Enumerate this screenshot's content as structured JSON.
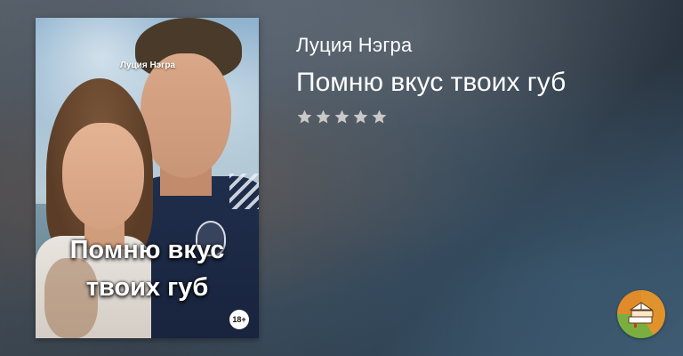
{
  "book": {
    "author": "Луция Нэгра",
    "title": "Помню вкус твоих губ",
    "rating_stars_filled": 0,
    "rating_stars_total": 5,
    "star_color": "#c9c9c9"
  },
  "cover": {
    "author": "Луция Нэгра",
    "title_line1": "Помню вкус",
    "title_line2": "твоих губ",
    "age_rating": "18+"
  },
  "logo": {
    "icon": "book-stack-icon"
  }
}
